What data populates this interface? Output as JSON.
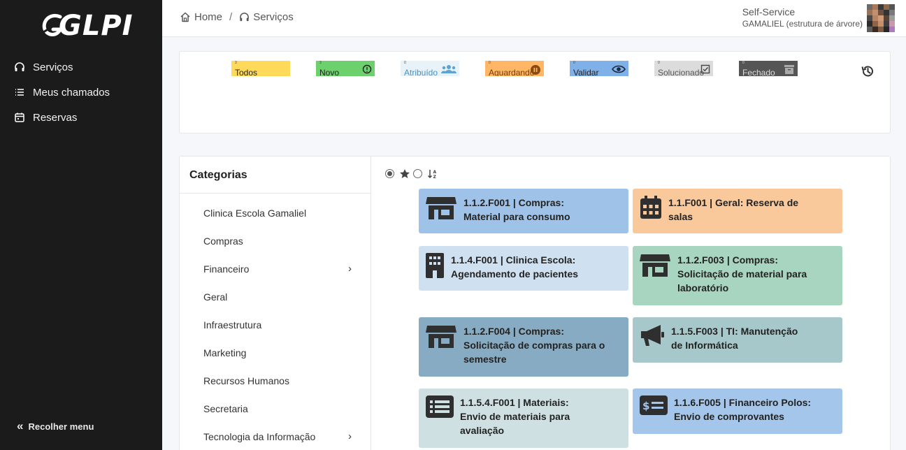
{
  "app": {
    "logo_text": "GLPI"
  },
  "sidebar": {
    "items": [
      {
        "label": "Serviços",
        "icon": "headset-icon"
      },
      {
        "label": "Meus chamados",
        "icon": "list-icon"
      },
      {
        "label": "Reservas",
        "icon": "calendar-icon"
      }
    ],
    "collapse_label": "Recolher menu"
  },
  "breadcrumb": {
    "home": "Home",
    "separator": "/",
    "current": "Serviços"
  },
  "profile": {
    "name": "Self-Service",
    "entity": "GAMALIEL (estrutura de árvore)"
  },
  "status_tiles": [
    {
      "count": "3",
      "label": "Todos",
      "color": "#ffd95a",
      "icon": ""
    },
    {
      "count": "3",
      "label": "Novo",
      "color": "#6cd06c",
      "icon": "alert-circle-icon"
    },
    {
      "count": "0",
      "label": "Atribuído",
      "color": "#e8f3f9",
      "icon": "users-icon"
    },
    {
      "count": "0",
      "label": "Aguardando",
      "color": "#ffb766",
      "icon": "pause-circle-icon"
    },
    {
      "count": "0",
      "label": "Validar",
      "color": "#7fb0e8",
      "icon": "eye-icon"
    },
    {
      "count": "0",
      "label": "Solucionado",
      "color": "#dcdcdc",
      "icon": "check-square-icon"
    },
    {
      "count": "0",
      "label": "Fechado",
      "color": "#555555",
      "icon": "archive-icon"
    }
  ],
  "categories": {
    "title": "Categorias",
    "items": [
      {
        "label": "Clinica Escola Gamaliel",
        "has_children": false
      },
      {
        "label": "Compras",
        "has_children": false
      },
      {
        "label": "Financeiro",
        "has_children": true
      },
      {
        "label": "Geral",
        "has_children": false
      },
      {
        "label": "Infraestrutura",
        "has_children": false
      },
      {
        "label": "Marketing",
        "has_children": false
      },
      {
        "label": "Recursos Humanos",
        "has_children": false
      },
      {
        "label": "Secretaria",
        "has_children": false
      },
      {
        "label": "Tecnologia da Informação",
        "has_children": true
      }
    ]
  },
  "services": [
    {
      "title": "1.1.2.F001 | Compras: Material para consumo",
      "color": "#9fc3e8",
      "icon": "store-icon"
    },
    {
      "title": "1.1.F001 | Geral: Reserva de salas",
      "color": "#f9c99b",
      "icon": "calendar-grid-icon"
    },
    {
      "title": "1.1.4.F001 | Clinica Escola: Agendamento de pacientes",
      "color": "#cfe1f0",
      "icon": "building-icon"
    },
    {
      "title": "1.1.2.F003 | Compras: Solicitação de material para laboratório",
      "color": "#a8d5bf",
      "icon": "store-icon"
    },
    {
      "title": "1.1.2.F004 | Compras: Solicitação de compras para o semestre",
      "color": "#86abc2",
      "icon": "store-icon"
    },
    {
      "title": "1.1.5.F003 | TI: Manutenção de Informática",
      "color": "#a7c8ca",
      "icon": "megaphone-icon"
    },
    {
      "title": "1.1.5.4.F001 | Materiais: Envio de materiais para avaliação",
      "color": "#cfe0e2",
      "icon": "list-alt-icon"
    },
    {
      "title": "1.1.6.F005 | Financeiro Polos: Envio de comprovantes",
      "color": "#a4c6ea",
      "icon": "money-bill-icon"
    }
  ]
}
